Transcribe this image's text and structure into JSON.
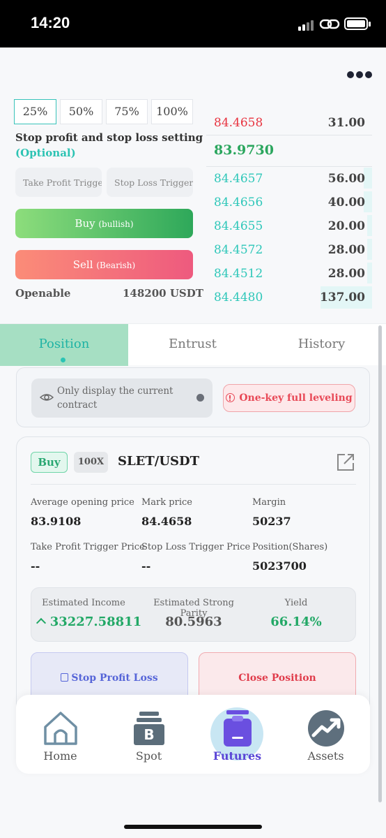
{
  "status_bar": {
    "time": "14:20"
  },
  "order_form": {
    "percent_options": [
      "25%",
      "50%",
      "75%",
      "100%"
    ],
    "stop_profit_title": "Stop profit and stop loss setting",
    "stop_profit_optional": "(Optional)",
    "take_profit_placeholder": "Take Profit Trigger Price",
    "stop_loss_placeholder": "Stop Loss Trigger Price",
    "buy_label": "Buy",
    "buy_sub": "(bullish)",
    "sell_label": "Sell",
    "sell_sub": "(Bearish)",
    "openable_label": "Openable",
    "openable_value": "148200 USDT"
  },
  "order_book": {
    "asks": [
      {
        "price": "84.4658",
        "qty": "31.00"
      }
    ],
    "mid_price": "83.9730",
    "bids": [
      {
        "price": "84.4657",
        "qty": "56.00",
        "depth": 0.05
      },
      {
        "price": "84.4656",
        "qty": "40.00",
        "depth": 0.05
      },
      {
        "price": "84.4655",
        "qty": "20.00",
        "depth": 0.03
      },
      {
        "price": "84.4572",
        "qty": "28.00",
        "depth": 0.03
      },
      {
        "price": "84.4512",
        "qty": "28.00",
        "depth": 0.03
      },
      {
        "price": "84.4480",
        "qty": "137.00",
        "depth": 0.31
      }
    ],
    "colors": {
      "ask": "#e8333f",
      "bid": "#2ec7b9",
      "mid": "#2ba65e"
    }
  },
  "tabs": [
    "Position",
    "Entrust",
    "History"
  ],
  "filter": {
    "display_current_label": "Only display the current contract",
    "full_leveling_label": "One-key full leveling"
  },
  "position": {
    "side": "Buy",
    "leverage": "100X",
    "pair": "SLET/USDT",
    "fields": {
      "avg_open_price_label": "Average opening price",
      "avg_open_price": "83.9108",
      "mark_price_label": "Mark price",
      "mark_price": "84.4658",
      "margin_label": "Margin",
      "margin": "50237",
      "take_profit_label": "Take Profit Trigger Price",
      "take_profit": "--",
      "stop_loss_label": "Stop Loss Trigger Price",
      "stop_loss": "--",
      "shares_label": "Position(Shares)",
      "shares": "5023700"
    },
    "estimates": {
      "income_label": "Estimated Income",
      "income": "33227.58811",
      "parity_label": "Estimated Strong Parity",
      "parity": "80.5963",
      "yield_label": "Yield",
      "yield": "66.14%"
    },
    "stop_profit_loss_label": "Stop Profit Loss",
    "close_position_label": "Close Position"
  },
  "bottom_nav": [
    {
      "label": "Home",
      "icon": "home-icon"
    },
    {
      "label": "Spot",
      "icon": "spot-bitcoin-icon"
    },
    {
      "label": "Futures",
      "icon": "futures-clipboard-icon",
      "active": true
    },
    {
      "label": "Assets",
      "icon": "assets-chart-icon"
    }
  ]
}
